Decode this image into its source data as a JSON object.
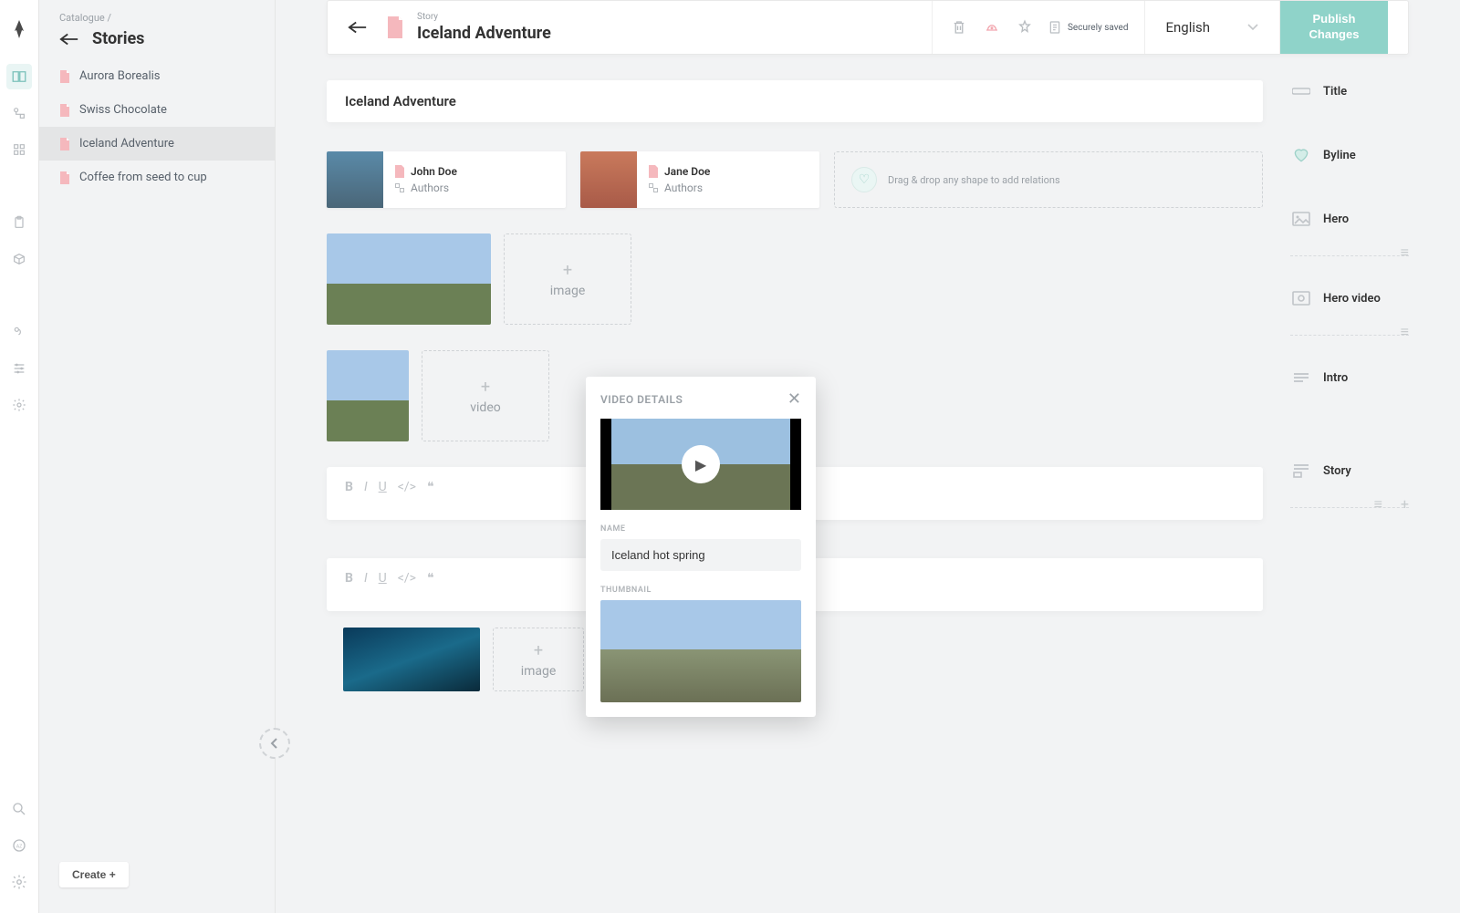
{
  "breadcrumb": {
    "root": "Catalogue"
  },
  "sidebar": {
    "title": "Stories",
    "items": [
      {
        "label": "Aurora Borealis"
      },
      {
        "label": "Swiss Chocolate"
      },
      {
        "label": "Iceland Adventure",
        "selected": true
      },
      {
        "label": "Coffee from seed to cup"
      }
    ],
    "create": "Create +"
  },
  "topbar": {
    "type_label": "Story",
    "title": "Iceland Adventure",
    "saved_text": "Securely saved",
    "language": "English",
    "publish": "Publish Changes"
  },
  "editor": {
    "title_value": "Iceland Adventure",
    "authors": [
      {
        "name": "John Doe",
        "role": "Authors"
      },
      {
        "name": "Jane Doe",
        "role": "Authors"
      }
    ],
    "drop_relation": "Drag & drop any shape to add relations",
    "drop_image": "image",
    "drop_video": "video"
  },
  "outline": {
    "items": [
      {
        "label": "Title"
      },
      {
        "label": "Byline"
      },
      {
        "label": "Hero"
      },
      {
        "label": "Hero video"
      },
      {
        "label": "Intro"
      },
      {
        "label": "Story"
      }
    ]
  },
  "popover": {
    "title": "VIDEO DETAILS",
    "name_label": "NAME",
    "name_value": "Iceland hot spring",
    "thumb_label": "THUMBNAIL"
  }
}
